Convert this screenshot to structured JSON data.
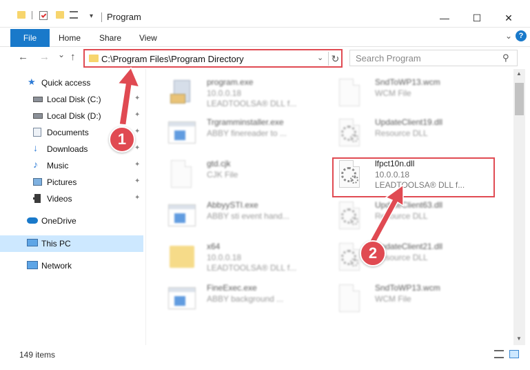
{
  "window": {
    "title": "Program",
    "minimize": "—",
    "maximize": "☐",
    "close": "✕"
  },
  "ribbon": {
    "file": "File",
    "tabs": [
      "Home",
      "Share",
      "View"
    ],
    "expand": "⌄",
    "help": "?"
  },
  "nav": {
    "back": "←",
    "forward": "→",
    "recent": "⌄",
    "up": "↑",
    "address": "C:\\Program Files\\Program Directory",
    "address_dropdown": "⌄",
    "refresh": "↻",
    "search_placeholder": "Search Program",
    "search_icon_glyph": "⚲"
  },
  "sidebar": {
    "items": [
      {
        "label": "Quick access",
        "icon": "star-icon",
        "pinned": false,
        "selected": false
      },
      {
        "label": "Local Disk (C:)",
        "icon": "drive-icon",
        "pinned": true,
        "selected": false
      },
      {
        "label": "Local Disk (D:)",
        "icon": "drive-icon",
        "pinned": true,
        "selected": false
      },
      {
        "label": "Documents",
        "icon": "documents-icon",
        "pinned": true,
        "selected": false
      },
      {
        "label": "Downloads",
        "icon": "download-icon",
        "pinned": true,
        "selected": false
      },
      {
        "label": "Music",
        "icon": "music-icon",
        "pinned": true,
        "selected": false
      },
      {
        "label": "Pictures",
        "icon": "pictures-icon",
        "pinned": true,
        "selected": false
      },
      {
        "label": "Videos",
        "icon": "videos-icon",
        "pinned": true,
        "selected": false
      },
      {
        "label": "OneDrive",
        "icon": "cloud-icon",
        "pinned": false,
        "selected": false
      },
      {
        "label": "This PC",
        "icon": "computer-icon",
        "pinned": false,
        "selected": true
      },
      {
        "label": "Network",
        "icon": "network-icon",
        "pinned": false,
        "selected": false
      }
    ],
    "pin_glyph": "📌"
  },
  "files": [
    {
      "name": "program.exe",
      "line2": "10.0.0.18",
      "line3": "LEADTOOLSA® DLL f...",
      "icon": "installer-icon",
      "highlight": false
    },
    {
      "name": "SndToWP13.wcm",
      "line2": "WCM File",
      "line3": "",
      "icon": "document-icon",
      "highlight": false
    },
    {
      "name": "Trgramminstaller.exe",
      "line2": "ABBY finereader to ...",
      "line3": "",
      "icon": "window-app-icon",
      "highlight": false
    },
    {
      "name": "UpdateClient19.dll",
      "line2": "Resource DLL",
      "line3": "",
      "icon": "dll-gear-icon",
      "highlight": false
    },
    {
      "name": "gtd.cjk",
      "line2": "CJK File",
      "line3": "",
      "icon": "document-icon",
      "highlight": false
    },
    {
      "name": "lfpct10n.dll",
      "line2": "10.0.0.18",
      "line3": "LEADTOOLSA® DLL f...",
      "icon": "dll-gear-icon",
      "highlight": true
    },
    {
      "name": "AbbyySTI.exe",
      "line2": "ABBY sti event hand...",
      "line3": "",
      "icon": "window-app-icon",
      "highlight": false
    },
    {
      "name": "UpdateClient63.dll",
      "line2": "Resource DLL",
      "line3": "",
      "icon": "dll-gear-icon",
      "highlight": false
    },
    {
      "name": "x64",
      "line2": "10.0.0.18",
      "line3": "LEADTOOLSA® DLL f...",
      "icon": "folder-icon",
      "highlight": false
    },
    {
      "name": "UpdateClient21.dll",
      "line2": "Resource DLL",
      "line3": "",
      "icon": "dll-gear-icon",
      "highlight": false
    },
    {
      "name": "FineExec.exe",
      "line2": "ABBY background ...",
      "line3": "",
      "icon": "window-app-icon",
      "highlight": false
    },
    {
      "name": "SndToWP13.wcm",
      "line2": "WCM File",
      "line3": "",
      "icon": "document-icon",
      "highlight": false
    }
  ],
  "status": {
    "count": "149 items"
  },
  "callouts": {
    "one": "1",
    "two": "2"
  },
  "colors": {
    "accent": "#1979ca",
    "highlight_red": "#e04a52",
    "selected_bg": "#cde8ff"
  }
}
